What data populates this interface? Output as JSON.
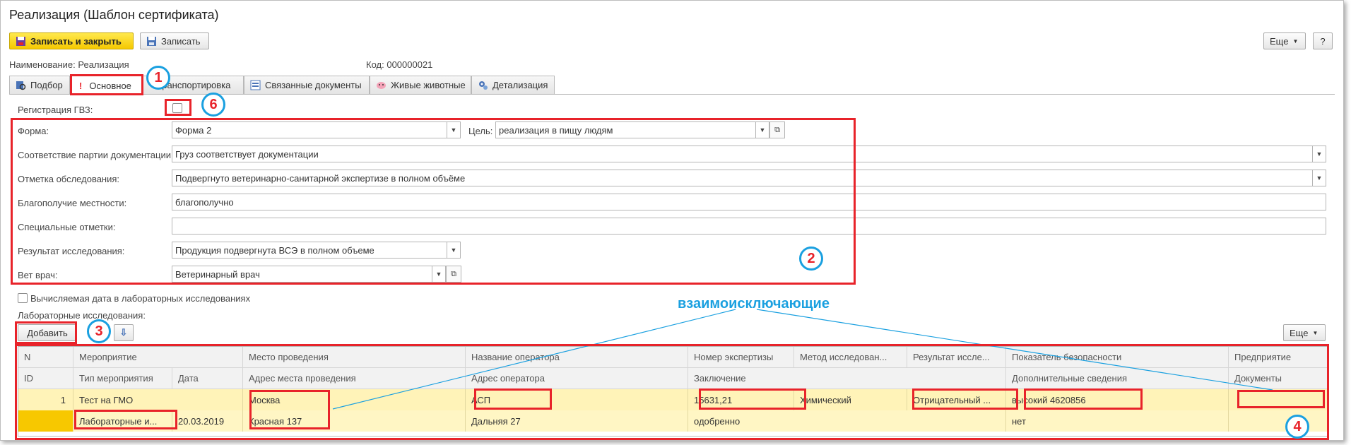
{
  "window": {
    "title": "Реализация (Шаблон сертификата)"
  },
  "toolbar": {
    "save_close": "Записать и закрыть",
    "save": "Записать",
    "more": "Еще",
    "help": "?"
  },
  "header": {
    "name_label": "Наименование:",
    "name_value": "Реализация",
    "code_label": "Код:",
    "code_value": "000000021"
  },
  "tabs": [
    "Подбор",
    "Основное",
    "Транспортировка",
    "Связанные документы",
    "Живые животные",
    "Детализация"
  ],
  "form": {
    "reg_gvz_label": "Регистрация ГВЗ:",
    "forma_label": "Форма:",
    "forma_value": "Форма 2",
    "goal_label": "Цель:",
    "goal_value": "реализация в пищу людям",
    "match_label": "Соответствие партии документации:",
    "match_value": "Груз соответствует документации",
    "mark_label": "Отметка обследования:",
    "mark_value": "Подвергнуто ветеринарно-санитарной экспертизе в полном объёме",
    "welfare_label": "Благополучие местности:",
    "welfare_value": "благополучно",
    "special_label": "Специальные отметки:",
    "special_value": "",
    "result_label": "Результат исследования:",
    "result_value": "Продукция подвергнута ВСЭ в полном объеме",
    "vet_label": "Вет врач:",
    "vet_value": "Ветеринарный врач",
    "calc_date_label": "Вычисляемая дата в лабораторных исследованиях",
    "lab_label": "Лабораторные исследования:"
  },
  "lab_toolbar": {
    "add": "Добавить",
    "more": "Еще"
  },
  "table": {
    "header1": [
      "N",
      "Мероприятие",
      "Место проведения",
      "Название оператора",
      "Номер экспертизы",
      "Метод исследован...",
      "Результат иссле...",
      "Показатель безопасности",
      "Предприятие"
    ],
    "header2": [
      "ID",
      "Тип мероприятия",
      "Дата",
      "Адрес места проведения",
      "Адрес оператора",
      "Заключение",
      "Дополнительные сведения",
      "Документы"
    ],
    "row1": [
      "1",
      "Тест на ГМО",
      "Москва",
      "АСП",
      "15631,21",
      "Химический",
      "Отрицательный ...",
      "высокий 4620856",
      ""
    ],
    "row2": [
      "",
      "Лабораторные и...",
      "20.03.2019",
      "Красная 137",
      "Дальняя 27",
      "одобренно",
      "нет",
      ""
    ]
  },
  "annotations": {
    "exclusive": "взаимоисключающие",
    "n1": "1",
    "n2": "2",
    "n3": "3",
    "n4": "4",
    "n6": "6"
  },
  "colors": {
    "accent_red": "#e8232a",
    "callout_blue": "#1aa0e0",
    "yellow_button": "#f5c800",
    "row_highlight": "#fff3b8"
  }
}
